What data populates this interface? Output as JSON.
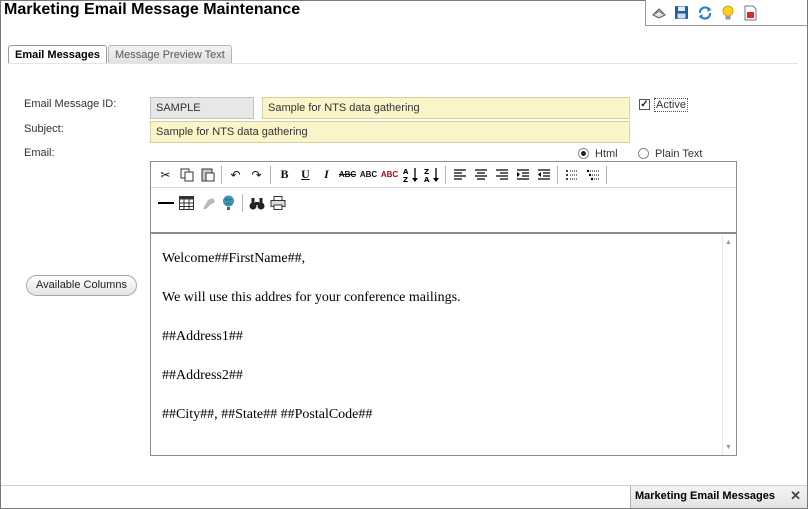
{
  "page": {
    "title": "Marketing Email Message Maintenance"
  },
  "topbar_icons": [
    "view-icon",
    "save-icon",
    "refresh-icon",
    "tips-lightbulb-icon",
    "pdf-report-icon"
  ],
  "tabs": [
    {
      "label": "Email Messages",
      "active": true
    },
    {
      "label": "Message Preview Text",
      "active": false
    }
  ],
  "form": {
    "message_id_label": "Email Message ID:",
    "message_id_value": "SAMPLE",
    "description_value": "Sample for NTS data gathering",
    "active_label": "Active",
    "active_checked": true,
    "subject_label": "Subject:",
    "subject_value": "Sample for NTS data gathering",
    "email_label": "Email:",
    "format_options": [
      {
        "label": "Html",
        "selected": true
      },
      {
        "label": "Plain Text",
        "selected": false
      }
    ]
  },
  "editor": {
    "toolbar_row1": [
      "cut",
      "copy",
      "paste",
      "|",
      "undo",
      "redo",
      "|",
      "bold",
      "underline",
      "italic",
      "strikethrough",
      "subscript",
      "superscript",
      "sort-ascending",
      "sort-descending",
      "|",
      "align-left",
      "align-center",
      "align-right",
      "indent",
      "outdent",
      "|",
      "ordered-list",
      "unordered-list",
      "|"
    ],
    "toolbar_row2": [
      "horizontal-rule",
      "table",
      "image",
      "hyperlink",
      "|",
      "find",
      "print"
    ],
    "toolbar_text": {
      "bold": "B",
      "underline": "U",
      "italic": "I",
      "strikethrough": "ABC",
      "subscript": "ABC",
      "superscript": "ABC"
    },
    "content_lines": [
      "Welcome##FirstName##,",
      "We will use this addres for your conference mailings.",
      "##Address1##",
      "##Address2##",
      "##City##, ##State##  ##PostalCode##"
    ]
  },
  "buttons": {
    "available_columns": "Available Columns"
  },
  "bottom_tab": {
    "label": "Marketing Email Messages"
  },
  "colors": {
    "readonly_field": "#e7e7e7",
    "highlight_field": "#fbf5c9",
    "border": "#8c8c8c"
  }
}
